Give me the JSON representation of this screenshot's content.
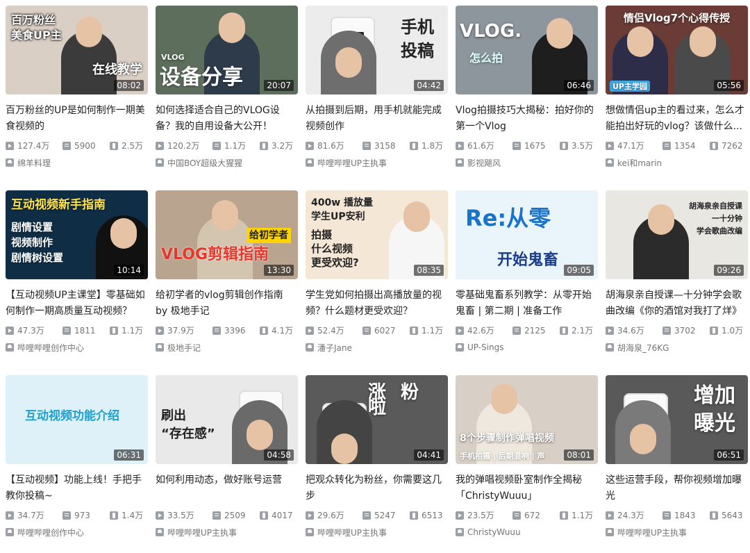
{
  "videos": [
    {
      "thumb_text": "百万粉丝\n美食UP主",
      "thumb_text2": "在线教学",
      "duration": "08:02",
      "title": "百万粉丝的UP是如何制作一期美食视频的",
      "plays": "127.4万",
      "danmu": "5900",
      "coins": "2.5万",
      "author": "绵羊料理",
      "bg": "#d9cfc5",
      "accent": "#2c3e50"
    },
    {
      "thumb_text": "VLOG",
      "thumb_text2": "设备分享",
      "duration": "20:07",
      "title": "如何选择适合自己的VLOG设备？我的自用设备大公开！",
      "plays": "120.2万",
      "danmu": "1.1万",
      "coins": "3.2万",
      "author": "中国BOY超级大猩猩",
      "bg": "#5e6e5d",
      "accent": "#ffffff"
    },
    {
      "thumb_text": "手机\n投稿",
      "thumb_text2": "",
      "duration": "04:42",
      "title": "从拍摄到后期，用手机就能完成视频创作",
      "plays": "81.6万",
      "danmu": "3158",
      "coins": "1.8万",
      "author": "哔哩哔哩UP主执事",
      "bg": "#ececec",
      "accent": "#222222"
    },
    {
      "thumb_text": "VLOG.",
      "thumb_text2": "怎么拍",
      "duration": "06:46",
      "title": "Vlog拍摄技巧大揭秘：拍好你的第一个Vlog",
      "plays": "61.6万",
      "danmu": "1675",
      "coins": "3.5万",
      "author": "影视飓风",
      "bg": "#8c969c",
      "accent": "#ffffff"
    },
    {
      "thumb_text": "情侣Vlog7个心得传授",
      "thumb_text2": "UP主学园",
      "duration": "05:56",
      "title": "想做情侣up主的看过来，怎么才能拍出好玩的vlog？该做什么...",
      "plays": "47.1万",
      "danmu": "1354",
      "coins": "7262",
      "author": "kei和marin",
      "bg": "#6b3b35",
      "accent": "#ffffff"
    },
    {
      "thumb_text": "互动视频新手指南",
      "thumb_text2": "剧情设置\n视频制作\n剧情树设置",
      "duration": "10:14",
      "title": "【互动视频UP主课堂】零基础如何制作一期高质量互动视频？",
      "plays": "47.3万",
      "danmu": "1811",
      "coins": "1.1万",
      "author": "哔哩哔哩创作中心",
      "bg": "#0f2e46",
      "accent": "#ffe24a"
    },
    {
      "thumb_text": "给初学者",
      "thumb_text2": "VLOG剪辑指南",
      "duration": "13:30",
      "title": "给初学者的vlog剪辑创作指南 by 极地手记",
      "plays": "37.9万",
      "danmu": "3396",
      "coins": "4.1万",
      "author": "极地手记",
      "bg": "#b9a58f",
      "accent": "#e6372c"
    },
    {
      "thumb_text": "400w 播放量\n学生UP安利",
      "thumb_text2": "拍摄\n什么视频\n更受欢迎?",
      "duration": "08:35",
      "title": "学生党如何拍摄出高播放量的视频？什么题材更受欢迎？",
      "plays": "52.4万",
      "danmu": "6027",
      "coins": "1.1万",
      "author": "潘子Jane",
      "bg": "#f4e7d6",
      "accent": "#222222"
    },
    {
      "thumb_text": "Re:从零",
      "thumb_text2": "开始鬼畜",
      "duration": "09:05",
      "title": "零基础鬼畜系列教学：从零开始鬼畜 | 第二期 | 准备工作",
      "plays": "42.6万",
      "danmu": "2125",
      "coins": "2.1万",
      "author": "UP-Sings",
      "bg": "#eaf4fb",
      "accent": "#1a73c9"
    },
    {
      "thumb_text": "胡海泉亲自授课\n一十分钟\n学会歌曲改编",
      "thumb_text2": "",
      "duration": "09:26",
      "title": "胡海泉亲自授课—十分钟学会歌曲改编《你的酒馆对我打了烊》",
      "plays": "34.6万",
      "danmu": "3702",
      "coins": "1.0万",
      "author": "胡海泉_76KG",
      "bg": "#e9e7e2",
      "accent": "#2b2b2b"
    },
    {
      "thumb_text": "互动视频功能介绍",
      "thumb_text2": "",
      "duration": "06:31",
      "title": "【互动视频】功能上线！手把手教你投稿~",
      "plays": "34.7万",
      "danmu": "973",
      "coins": "1.4万",
      "author": "哔哩哔哩创作中心",
      "bg": "#dff1f8",
      "accent": "#1d9fd2"
    },
    {
      "thumb_text": "刷出\n“存在感”",
      "thumb_text2": "",
      "duration": "04:58",
      "title": "如何利用动态，做好账号运营",
      "plays": "33.5万",
      "danmu": "2509",
      "coins": "4017",
      "author": "哔哩哔哩UP主执事",
      "bg": "#e9e9e9",
      "accent": "#222222"
    },
    {
      "thumb_text": "涨 粉 啦",
      "thumb_text2": "",
      "duration": "04:41",
      "title": "把观众转化为粉丝，你需要这几步",
      "plays": "29.6万",
      "danmu": "5247",
      "coins": "6513",
      "author": "哔哩哔哩UP主执事",
      "bg": "#5a5a5a",
      "accent": "#ffffff"
    },
    {
      "thumb_text": "8个步骤制作弹唱视频",
      "thumb_text2": "手机拍摄 | 后期混响 | 声",
      "duration": "08:01",
      "title": "我的弹唱视频卧室制作全揭秘「ChristyWuuu」",
      "plays": "23.5万",
      "danmu": "672",
      "coins": "1.1万",
      "author": "ChristyWuuu",
      "bg": "#d8cfc7",
      "accent": "#ffffff"
    },
    {
      "thumb_text": "增加\n曝光",
      "thumb_text2": "",
      "duration": "06:51",
      "title": "这些运营手段，帮你视频增加曝光",
      "plays": "24.3万",
      "danmu": "1843",
      "coins": "5643",
      "author": "哔哩哔哩UP主执事",
      "bg": "#595959",
      "accent": "#ffffff"
    }
  ]
}
